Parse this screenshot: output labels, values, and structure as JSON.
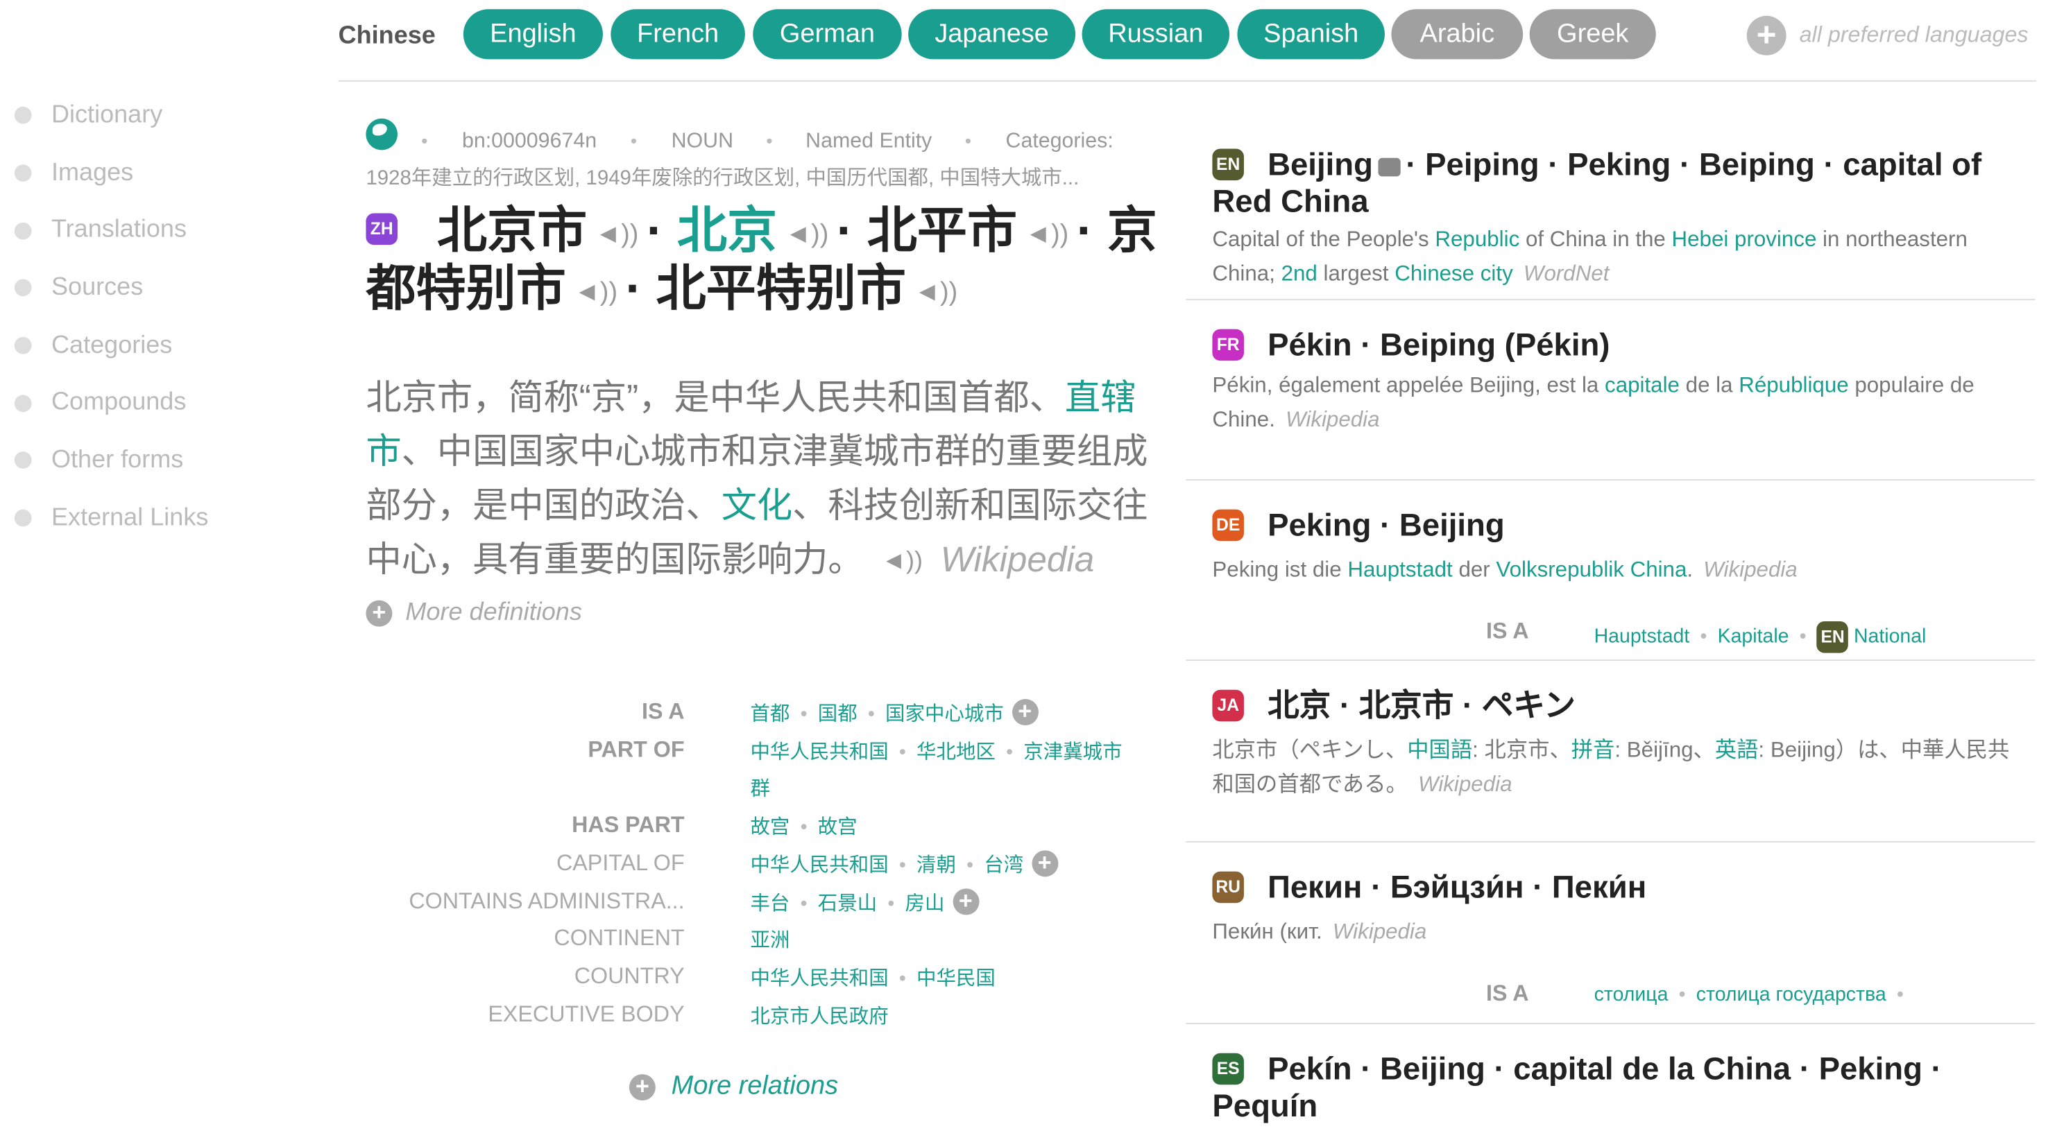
{
  "languages": {
    "current": "Chinese",
    "active": [
      "English",
      "French",
      "German",
      "Japanese",
      "Russian",
      "Spanish"
    ],
    "inactive": [
      "Arabic",
      "Greek"
    ],
    "preferred_label": "all preferred languages"
  },
  "sidebar": {
    "items": [
      "Dictionary",
      "Images",
      "Translations",
      "Sources",
      "Categories",
      "Compounds",
      "Other forms",
      "External Links"
    ]
  },
  "meta": {
    "sep": "•",
    "id": "bn:00009674n",
    "pos": "NOUN",
    "type": "Named Entity",
    "categories_label": "Categories:",
    "categories": "1928年建立的行政区划, 1949年废除的行政区划, 中国历代国都, 中国特大城市..."
  },
  "zh": {
    "badge": "ZH",
    "lemmas": [
      "北京市",
      "北京",
      "北平市",
      "京都特别市",
      "北平特别市"
    ],
    "sep": "·",
    "gloss_parts": [
      "北京市，简称“京”，是中华人民共和国首都、",
      "直辖市",
      "、中国国家中心城市和京津冀城市群的重要组成部分，是中国的政治、",
      "文化",
      "、科技创新和国际交往中心，具有重要的国际影响力。"
    ],
    "gloss_source": "Wikipedia",
    "more_definitions": "More definitions"
  },
  "relations": [
    {
      "label": "IS A",
      "bold": true,
      "values": [
        "首都",
        "国都",
        "国家中心城市"
      ],
      "plus": true
    },
    {
      "label": "PART OF",
      "bold": true,
      "values": [
        "中华人民共和国",
        "华北地区",
        "京津冀城市"
      ],
      "wrap": "群"
    },
    {
      "label": "HAS PART",
      "bold": true,
      "values": [
        "故宫",
        "故宫"
      ]
    },
    {
      "label": "CAPITAL OF",
      "values": [
        "中华人民共和国",
        "清朝",
        "台湾"
      ],
      "plus": true
    },
    {
      "label": "CONTAINS ADMINISTRA...",
      "values": [
        "丰台",
        "石景山",
        "房山"
      ],
      "plus": true
    },
    {
      "label": "CONTINENT",
      "values": [
        "亚洲"
      ]
    },
    {
      "label": "COUNTRY",
      "values": [
        "中华人民共和国",
        "中华民国"
      ]
    },
    {
      "label": "EXECUTIVE BODY",
      "values": [
        "北京市人民政府"
      ]
    }
  ],
  "more_relations": "More relations",
  "cards": [
    {
      "badge": "EN",
      "title_a": "Beijing",
      "title_b": "· Peiping · Peking · Beiping · capital of Red China",
      "gloss": [
        [
          "Capital of the People's ",
          0
        ],
        [
          "Republic",
          1
        ],
        [
          " of China in the ",
          0
        ],
        [
          "Hebei province",
          1
        ],
        [
          " in northeastern China; ",
          0
        ],
        [
          "2nd",
          1
        ],
        [
          " largest ",
          0
        ],
        [
          "Chinese city",
          1
        ]
      ],
      "source": "WordNet"
    },
    {
      "badge": "FR",
      "title_a": "Pékin · Beiping (Pékin)",
      "gloss": [
        [
          "Pékin, également appelée Beijing, est la ",
          0
        ],
        [
          "capitale",
          1
        ],
        [
          " de la ",
          0
        ],
        [
          "République",
          1
        ],
        [
          " populaire de Chine.",
          0
        ]
      ],
      "source": "Wikipedia"
    },
    {
      "badge": "DE",
      "title_a": "Peking · Beijing",
      "gloss": [
        [
          "Peking ist die ",
          0
        ],
        [
          "Hauptstadt",
          1
        ],
        [
          " der ",
          0
        ],
        [
          "Volksrepublik China",
          1
        ],
        [
          ".",
          0
        ]
      ],
      "source": "Wikipedia",
      "isa_label": "IS A",
      "isa": [
        "Hauptstadt",
        "Kapitale"
      ],
      "isa_en_badge": "EN",
      "isa_en": "National"
    },
    {
      "badge": "JA",
      "title_a": "北京 · 北京市 · ペキン",
      "gloss": [
        [
          "北京市（ペキンし、",
          0
        ],
        [
          "中国語",
          1
        ],
        [
          ": 北京市、",
          0
        ],
        [
          "拼音",
          1
        ],
        [
          ": Běijīng、",
          0
        ],
        [
          "英語",
          1
        ],
        [
          ": Beijing）は、中華人民共和国の首都である。",
          0
        ]
      ],
      "source": "Wikipedia"
    },
    {
      "badge": "RU",
      "title_a": "Пекин · Бэйцзи́н · Пеки́н",
      "gloss": [
        [
          "Пеки́н (кит.",
          0
        ]
      ],
      "source": "Wikipedia",
      "isa_label": "IS A",
      "isa": [
        "столица",
        "столица государства"
      ],
      "isa_trail": "•"
    },
    {
      "badge": "ES",
      "title_a": "Pekín · Beijing · capital de la China · Peking · Pequín"
    }
  ],
  "speaker_glyph": "◄))",
  "plus_glyph": "+"
}
